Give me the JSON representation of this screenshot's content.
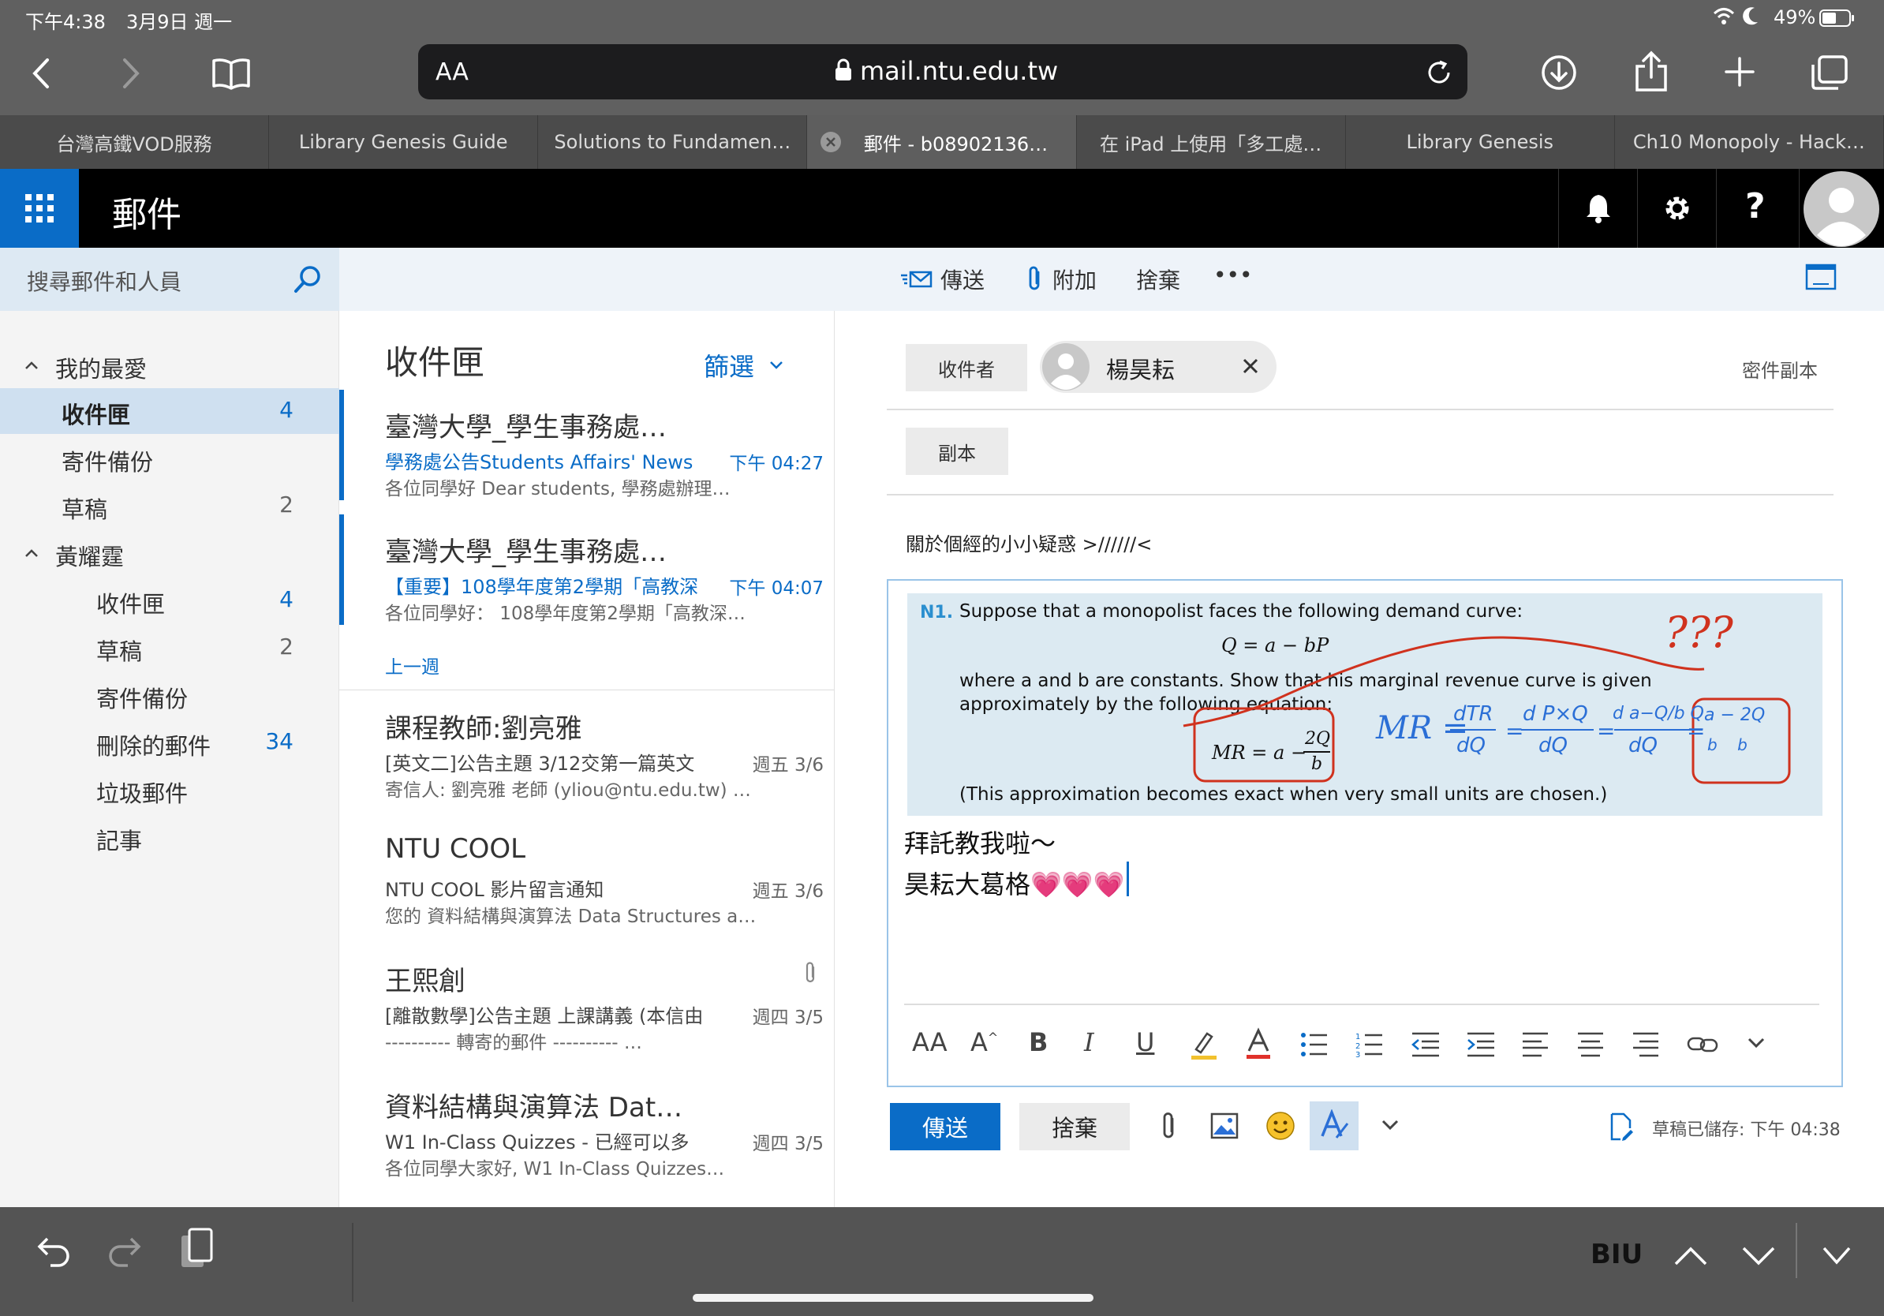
{
  "status": {
    "time": "下午4:38",
    "date": "3月9日 週一",
    "battery": "49%"
  },
  "safari": {
    "aa_label": "AA",
    "url": "mail.ntu.edu.tw"
  },
  "tabs": [
    "台灣高鐵VOD服務",
    "Library Genesis Guide",
    "Solutions to Fundamen…",
    "郵件 - b08902136…",
    "在 iPad 上使用「多工處…",
    "Library Genesis",
    "Ch10 Monopoly - Hack…"
  ],
  "header": {
    "title": "郵件"
  },
  "search": {
    "placeholder": "搜尋郵件和人員"
  },
  "command": {
    "send": "傳送",
    "attach": "附加",
    "discard": "捨棄",
    "more": "•••"
  },
  "folders": {
    "favorites_label": "我的最愛",
    "favorites": [
      {
        "name": "收件匣",
        "count": "4"
      },
      {
        "name": "寄件備份",
        "count": ""
      },
      {
        "name": "草稿",
        "count": "2"
      }
    ],
    "account_label": "黃耀霆",
    "account": [
      {
        "name": "收件匣",
        "count": "4"
      },
      {
        "name": "草稿",
        "count": "2"
      },
      {
        "name": "寄件備份",
        "count": ""
      },
      {
        "name": "刪除的郵件",
        "count": "34"
      },
      {
        "name": "垃圾郵件",
        "count": ""
      },
      {
        "name": "記事",
        "count": ""
      }
    ]
  },
  "list": {
    "title": "收件匣",
    "filter": "篩選",
    "section_lastweek": "上一週",
    "messages": [
      {
        "from": "臺灣大學_學生事務處…",
        "subject": "學務處公告Students Affairs' News",
        "date": "下午 04:27",
        "preview": "各位同學好  Dear students,   學務處辦理…"
      },
      {
        "from": "臺灣大學_學生事務處…",
        "subject": "【重要】108學年度第2學期「高教深",
        "date": "下午 04:07",
        "preview": "各位同學好： 108學年度第2學期「高教深…"
      },
      {
        "from": "課程教師:劉亮雅",
        "subject": "[英文二]公告主題 3/12交第一篇英文",
        "date": "週五 3/6",
        "preview": "寄信人: 劉亮雅 老師 (yliou@ntu.edu.tw) …"
      },
      {
        "from": "NTU COOL",
        "subject": "NTU COOL 影片留言通知",
        "date": "週五 3/6",
        "preview": "您的 資料結構與演算法 Data Structures a…"
      },
      {
        "from": "王熙創",
        "subject": "[離散數學]公告主題 上課講義 (本信由",
        "date": "週四 3/5",
        "preview": "---------- 轉寄的郵件 ---------- …"
      },
      {
        "from": "資料結構與演算法 Dat…",
        "subject": "W1 In-Class Quizzes - 已經可以多",
        "date": "週四 3/5",
        "preview": "各位同學大家好,    W1 In-Class Quizzes…"
      }
    ]
  },
  "compose": {
    "to_label": "收件者",
    "recipient": "楊昊耘",
    "bcc_label": "密件副本",
    "cc_label": "副本",
    "subject": "關於個經的小小疑惑 >//////<",
    "problem": {
      "number": "N1.",
      "line1": "Suppose that a monopolist faces the following demand curve:",
      "eq1": "Q = a − bP",
      "line2": "where a and b are constants. Show that his marginal revenue curve is given",
      "line3": "approximately by the following equation:",
      "eq2_left": "MR = a −",
      "eq2_num": "2Q",
      "eq2_den": "b",
      "line4": "(This approximation becomes exact when very small units are chosen.)"
    },
    "annotation": {
      "question": "???",
      "mr": "MR =",
      "f1_num": "dTR",
      "f1_den": "dQ",
      "f2_num": "d P×Q",
      "f2_den": "dQ",
      "f3_num": "d a−Q/b Q",
      "f3_den": "dQ",
      "f4_num": "a − 2Q",
      "f4_den": "b    b"
    },
    "body_line1": "拜託教我啦～",
    "body_line2": "昊耘大葛格💗💗💗",
    "send": "傳送",
    "discard": "捨棄",
    "saved": "草稿已儲存: 下午 04:38"
  },
  "keyboard": {
    "biu": "BIU"
  },
  "colors": {
    "accent": "#0a6cc7",
    "annotation_red": "#d0321e",
    "annotation_blue": "#2b6fd6"
  }
}
